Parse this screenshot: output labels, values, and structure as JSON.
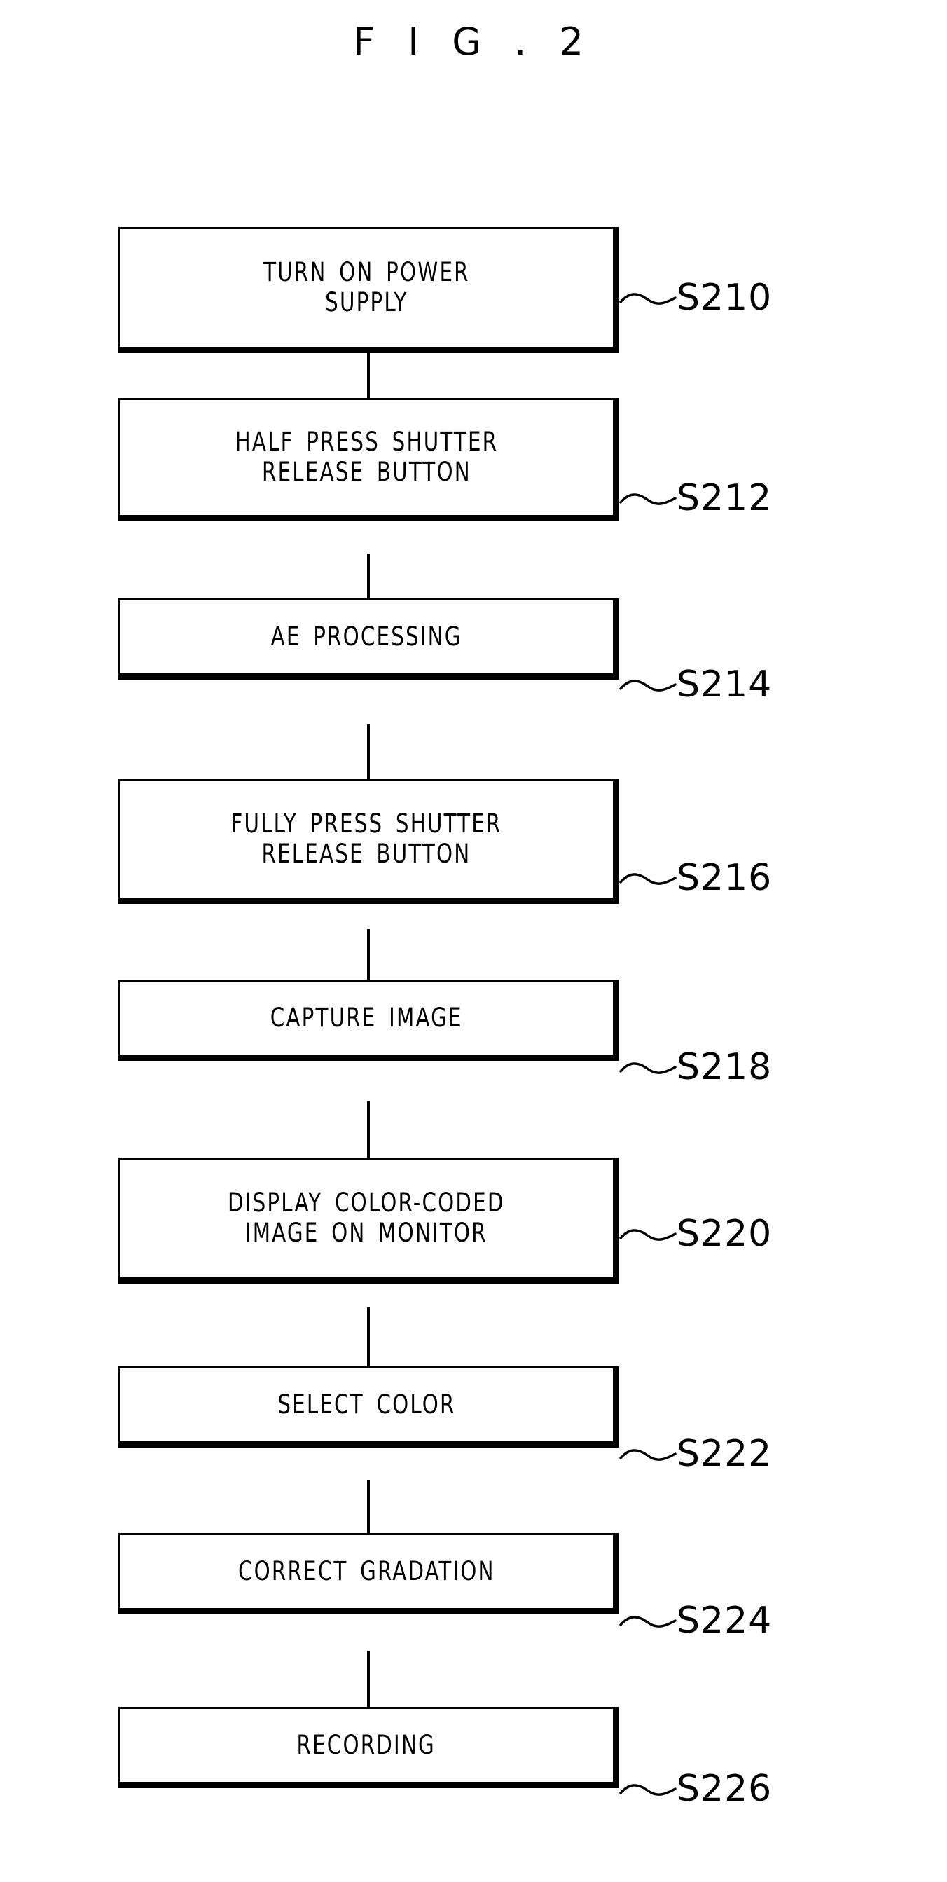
{
  "figure": {
    "title": "F I G . 2",
    "type": "process-flowchart"
  },
  "chart_data": {
    "type": "flowchart",
    "title": "F I G . 2",
    "orientation": "vertical",
    "node_count": 9,
    "nodes": [
      {
        "id": "S210",
        "label": "TURN ON POWER\nSUPPLY",
        "lines": 2
      },
      {
        "id": "S212",
        "label": "HALF PRESS SHUTTER\nRELEASE BUTTON",
        "lines": 2
      },
      {
        "id": "S214",
        "label": "AE PROCESSING",
        "lines": 1
      },
      {
        "id": "S216",
        "label": "FULLY PRESS SHUTTER\nRELEASE BUTTON",
        "lines": 2
      },
      {
        "id": "S218",
        "label": "CAPTURE IMAGE",
        "lines": 1
      },
      {
        "id": "S220",
        "label": "DISPLAY COLOR-CODED\nIMAGE ON MONITOR",
        "lines": 2
      },
      {
        "id": "S222",
        "label": "SELECT COLOR",
        "lines": 1
      },
      {
        "id": "S224",
        "label": "CORRECT GRADATION",
        "lines": 1
      },
      {
        "id": "S226",
        "label": "RECORDING",
        "lines": 1
      }
    ],
    "edges": [
      {
        "from": "S210",
        "to": "S212"
      },
      {
        "from": "S212",
        "to": "S214"
      },
      {
        "from": "S214",
        "to": "S216"
      },
      {
        "from": "S216",
        "to": "S218"
      },
      {
        "from": "S218",
        "to": "S220"
      },
      {
        "from": "S220",
        "to": "S222"
      },
      {
        "from": "S222",
        "to": "S224"
      },
      {
        "from": "S224",
        "to": "S226"
      }
    ],
    "colors": {
      "stroke": "#000000",
      "background": "#ffffff",
      "text": "#000000"
    }
  },
  "steps": [
    {
      "label": "TURN ON POWER\nSUPPLY",
      "ref": "S210"
    },
    {
      "label": "HALF PRESS SHUTTER\nRELEASE BUTTON",
      "ref": "S212"
    },
    {
      "label": "AE PROCESSING",
      "ref": "S214"
    },
    {
      "label": "FULLY PRESS SHUTTER\nRELEASE BUTTON",
      "ref": "S216"
    },
    {
      "label": "CAPTURE IMAGE",
      "ref": "S218"
    },
    {
      "label": "DISPLAY COLOR-CODED\nIMAGE ON MONITOR",
      "ref": "S220"
    },
    {
      "label": "SELECT COLOR",
      "ref": "S222"
    },
    {
      "label": "CORRECT GRADATION",
      "ref": "S224"
    },
    {
      "label": "RECORDING",
      "ref": "S226"
    }
  ]
}
